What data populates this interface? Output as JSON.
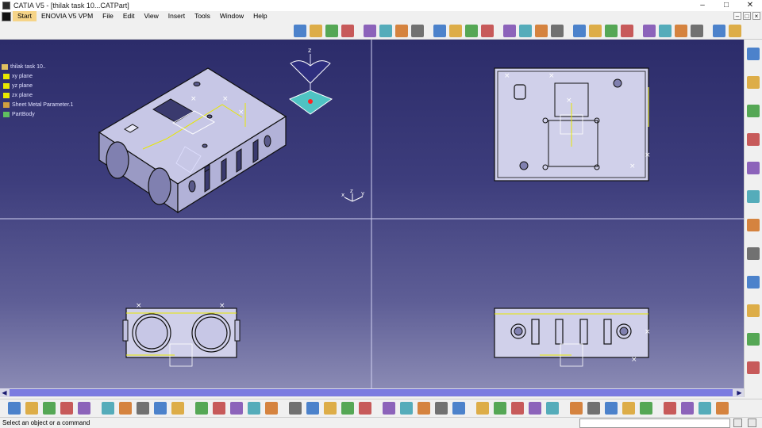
{
  "window": {
    "title": "CATIA V5 - [thilak task 10...CATPart]",
    "minimize": "–",
    "maximize": "□",
    "close": "✕"
  },
  "menu": [
    "Start",
    "ENOVIA V5 VPM",
    "File",
    "Edit",
    "View",
    "Insert",
    "Tools",
    "Window",
    "Help"
  ],
  "mdi_buttons": [
    "–",
    "□",
    "×"
  ],
  "tree": {
    "root": "thilak task 10..",
    "items": [
      "xy plane",
      "yz plane",
      "zx plane",
      "Sheet Metal Parameter.1",
      "PartBody"
    ]
  },
  "axis_labels": {
    "x": "x",
    "y": "y",
    "z": "z"
  },
  "scroll": {
    "left": "◀",
    "right": "▶"
  },
  "status": {
    "message": "Select an object or a command"
  },
  "colors": {
    "viewport_top": "#2c2c6a",
    "viewport_bottom": "#8a8ab4",
    "part_face": "#c7c7e6",
    "edge": "#101010",
    "constraint": "#e8e800",
    "compass_face": "#2e2e7e",
    "compass_base": "#4fc3c3"
  },
  "top_toolbar_icons": [
    "snapshot-icon",
    "sheet-metal-params-icon",
    "wall-icon",
    "wall-on-edge-icon",
    "extrusion-icon",
    "bend-icon",
    "unfold-icon",
    "fold-icon",
    "cutout-icon",
    "hole-icon",
    "corner-relief-icon",
    "stamp-icon",
    "pattern-icon",
    "mirror-icon",
    "view-3d-icon",
    "views-icon",
    "normal-view-icon",
    "shading-icon",
    "hide-show-icon",
    "swap-icon",
    "measure-icon",
    "analyze-icon",
    "axis-icon",
    "sketch-icon",
    "plane-icon",
    "point-icon"
  ],
  "bottom_toolbar_icons": [
    "new-icon",
    "open-icon",
    "save-icon",
    "print-icon",
    "cut-icon",
    "copy-icon",
    "paste-icon",
    "undo-icon",
    "redo-icon",
    "whats-this-icon",
    "formula-icon",
    "catalog-icon",
    "table-icon",
    "knowledge-icon",
    "sketch-analysis-icon",
    "fly-mode-icon",
    "fit-all-icon",
    "pan-icon",
    "rotate-icon",
    "zoom-in-icon",
    "zoom-out-icon",
    "normal-view-icon",
    "multi-view-icon",
    "iso-view-icon",
    "shading-icon",
    "hide-show-icon",
    "swap-visible-icon",
    "apply-material-icon",
    "measure-item-icon",
    "measure-between-icon",
    "snap-icon",
    "point-icon",
    "line-icon",
    "circle-icon",
    "constraint-icon",
    "axis-system-icon",
    "grid-icon",
    "dimension-icon",
    "catia-logo-icon"
  ],
  "right_toolbar_icons": [
    "sketcher-icon",
    "sketch-icon",
    "positioned-sketch-icon",
    "exit-sketch-icon",
    "select-icon",
    "edit-parameters-icon",
    "save-icon",
    "copy-icon",
    "paste-icon",
    "point-icon",
    "line-icon",
    "plane-icon"
  ]
}
